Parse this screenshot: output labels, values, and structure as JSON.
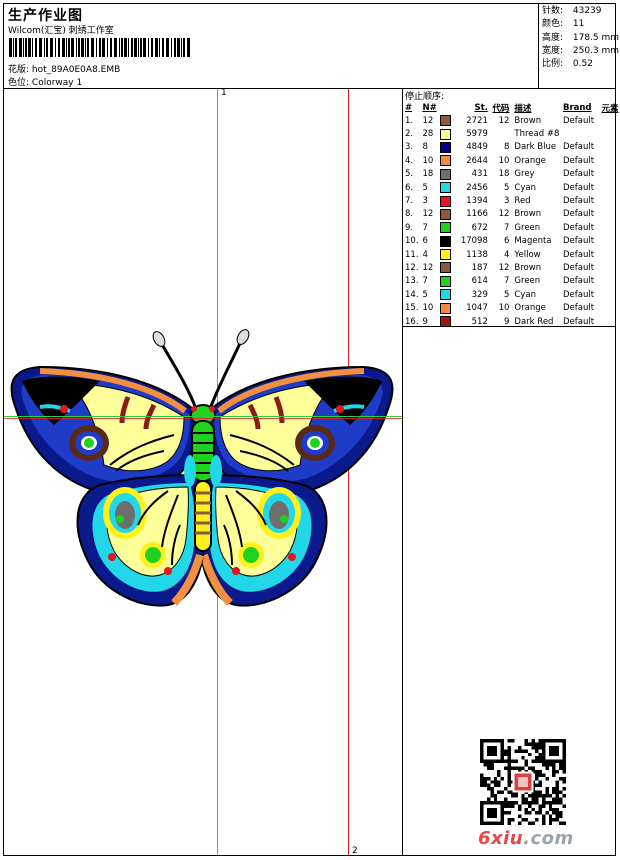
{
  "header": {
    "title": "生产作业图",
    "subtitle": "Wilcom(汇宝) 刺绣工作室",
    "design_file_label": "花版:",
    "design_file": "hot_89A0E0A8.EMB",
    "colorway_label": "色位:",
    "colorway": "Colorway 1"
  },
  "info": {
    "stitches_label": "针数:",
    "stitches": "43239",
    "colors_label": "颜色:",
    "colors": "11",
    "height_label": "高度:",
    "height": "178.5 mm",
    "width_label": "宽度:",
    "width": "250.3 mm",
    "ratio_label": "比例:",
    "ratio": "0.52"
  },
  "markers": {
    "one": "1",
    "two": "2"
  },
  "stops": {
    "title": "停止顺序:",
    "headers": {
      "idx": "#",
      "n": "N#",
      "st": "St.",
      "code": "代码",
      "desc": "描述",
      "brand": "Brand",
      "elem": "元素"
    },
    "rows": [
      {
        "idx": "1.",
        "n": "12",
        "color": "#8B5A3C",
        "st": "2721",
        "code": "12",
        "desc": "Brown",
        "brand": "Default"
      },
      {
        "idx": "2.",
        "n": "28",
        "color": "#FFFF99",
        "st": "5979",
        "code": "",
        "desc": "Thread #8",
        "brand": ""
      },
      {
        "idx": "3.",
        "n": "8",
        "color": "#00008B",
        "st": "4849",
        "code": "8",
        "desc": "Dark Blue",
        "brand": "Default"
      },
      {
        "idx": "4.",
        "n": "10",
        "color": "#F08C3C",
        "st": "2644",
        "code": "10",
        "desc": "Orange",
        "brand": "Default"
      },
      {
        "idx": "5.",
        "n": "18",
        "color": "#6E6E6E",
        "st": "431",
        "code": "18",
        "desc": "Grey",
        "brand": "Default"
      },
      {
        "idx": "6.",
        "n": "5",
        "color": "#22D8E8",
        "st": "2456",
        "code": "5",
        "desc": "Cyan",
        "brand": "Default"
      },
      {
        "idx": "7.",
        "n": "3",
        "color": "#E8141E",
        "st": "1394",
        "code": "3",
        "desc": "Red",
        "brand": "Default"
      },
      {
        "idx": "8.",
        "n": "12",
        "color": "#8B5A3C",
        "st": "1166",
        "code": "12",
        "desc": "Brown",
        "brand": "Default"
      },
      {
        "idx": "9.",
        "n": "7",
        "color": "#1ED21E",
        "st": "672",
        "code": "7",
        "desc": "Green",
        "brand": "Default"
      },
      {
        "idx": "10.",
        "n": "6",
        "color": "#000000",
        "st": "17098",
        "code": "6",
        "desc": "Magenta",
        "brand": "Default"
      },
      {
        "idx": "11.",
        "n": "4",
        "color": "#FFF01E",
        "st": "1138",
        "code": "4",
        "desc": "Yellow",
        "brand": "Default"
      },
      {
        "idx": "12.",
        "n": "12",
        "color": "#8B5A3C",
        "st": "187",
        "code": "12",
        "desc": "Brown",
        "brand": "Default"
      },
      {
        "idx": "13.",
        "n": "7",
        "color": "#1ED21E",
        "st": "614",
        "code": "7",
        "desc": "Green",
        "brand": "Default"
      },
      {
        "idx": "14.",
        "n": "5",
        "color": "#22D8E8",
        "st": "329",
        "code": "5",
        "desc": "Cyan",
        "brand": "Default"
      },
      {
        "idx": "15.",
        "n": "10",
        "color": "#F08C3C",
        "st": "1047",
        "code": "10",
        "desc": "Orange",
        "brand": "Default"
      },
      {
        "idx": "16.",
        "n": "9",
        "color": "#A01414",
        "st": "512",
        "code": "9",
        "desc": "Dark Red",
        "brand": "Default"
      }
    ]
  },
  "watermark": {
    "part1": "6xiu",
    "part2": ".com"
  }
}
